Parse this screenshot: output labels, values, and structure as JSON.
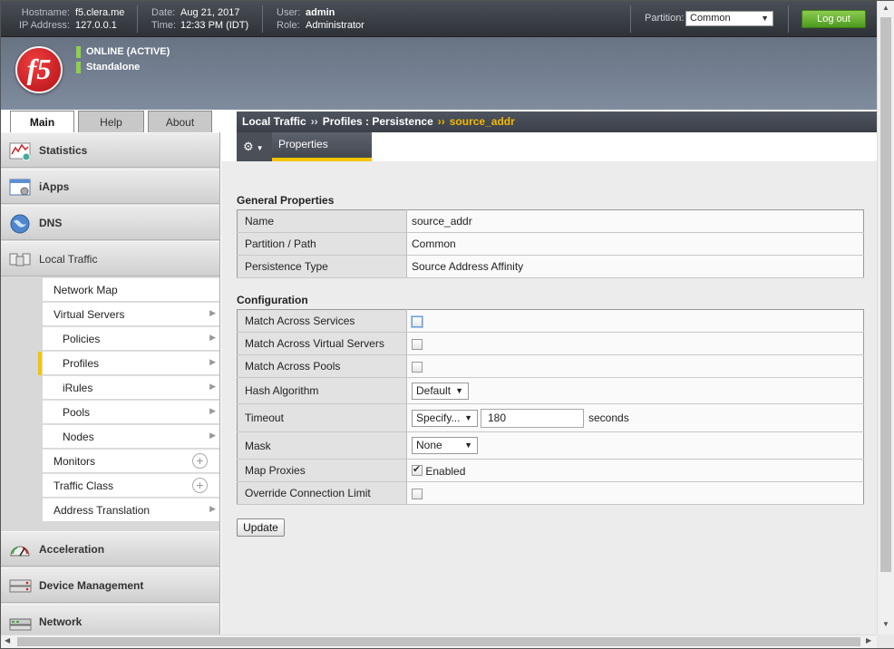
{
  "header": {
    "hostname_label": "Hostname:",
    "hostname": "f5.clera.me",
    "ip_label": "IP Address:",
    "ip": "127.0.0.1",
    "date_label": "Date:",
    "date": "Aug 21, 2017",
    "time_label": "Time:",
    "time": "12:33 PM (IDT)",
    "user_label": "User:",
    "user": "admin",
    "role_label": "Role:",
    "role": "Administrator",
    "partition_label": "Partition:",
    "partition_value": "Common",
    "logout_label": "Log out",
    "logo_text": "f5",
    "status_online": "ONLINE (ACTIVE)",
    "status_mode": "Standalone",
    "status_color": "#8fd04c"
  },
  "tabs": [
    {
      "label": "Main",
      "active": true
    },
    {
      "label": "Help",
      "active": false
    },
    {
      "label": "About",
      "active": false
    }
  ],
  "sidebar": {
    "sections": [
      {
        "label": "Statistics",
        "icon": "statistics-icon"
      },
      {
        "label": "iApps",
        "icon": "iapps-icon"
      },
      {
        "label": "DNS",
        "icon": "dns-globe-icon"
      },
      {
        "label": "Local Traffic",
        "icon": "local-traffic-icon"
      },
      {
        "label": "Acceleration",
        "icon": "acceleration-gauge-icon"
      },
      {
        "label": "Device Management",
        "icon": "device-management-icon"
      },
      {
        "label": "Network",
        "icon": "network-icon"
      }
    ],
    "local_traffic_items": [
      {
        "label": "Network Map",
        "indent": false,
        "control": "none"
      },
      {
        "label": "Virtual Servers",
        "indent": false,
        "control": "chevron"
      },
      {
        "label": "Policies",
        "indent": true,
        "control": "chevron"
      },
      {
        "label": "Profiles",
        "indent": true,
        "control": "chevron",
        "active": true
      },
      {
        "label": "iRules",
        "indent": true,
        "control": "chevron"
      },
      {
        "label": "Pools",
        "indent": true,
        "control": "chevron"
      },
      {
        "label": "Nodes",
        "indent": true,
        "control": "chevron"
      },
      {
        "label": "Monitors",
        "indent": false,
        "control": "plus"
      },
      {
        "label": "Traffic Class",
        "indent": false,
        "control": "plus"
      },
      {
        "label": "Address Translation",
        "indent": false,
        "control": "chevron"
      }
    ]
  },
  "breadcrumb": {
    "part1": "Local Traffic",
    "sep": "››",
    "part2": "Profiles : Persistence",
    "current": "source_addr"
  },
  "subnav": {
    "properties_tab": "Properties"
  },
  "general": {
    "title": "General Properties",
    "rows": [
      {
        "key": "Name",
        "value": "source_addr"
      },
      {
        "key": "Partition / Path",
        "value": "Common"
      },
      {
        "key": "Persistence Type",
        "value": "Source Address Affinity"
      }
    ]
  },
  "config": {
    "title": "Configuration",
    "match_services_label": "Match Across Services",
    "match_vs_label": "Match Across Virtual Servers",
    "match_pools_label": "Match Across Pools",
    "hash_label": "Hash Algorithm",
    "hash_value": "Default",
    "timeout_label": "Timeout",
    "timeout_mode": "Specify...",
    "timeout_value": "180",
    "timeout_unit": "seconds",
    "mask_label": "Mask",
    "mask_value": "None",
    "map_proxies_label": "Map Proxies",
    "map_proxies_checked_label": "Enabled",
    "override_label": "Override Connection Limit"
  },
  "update_label": "Update"
}
